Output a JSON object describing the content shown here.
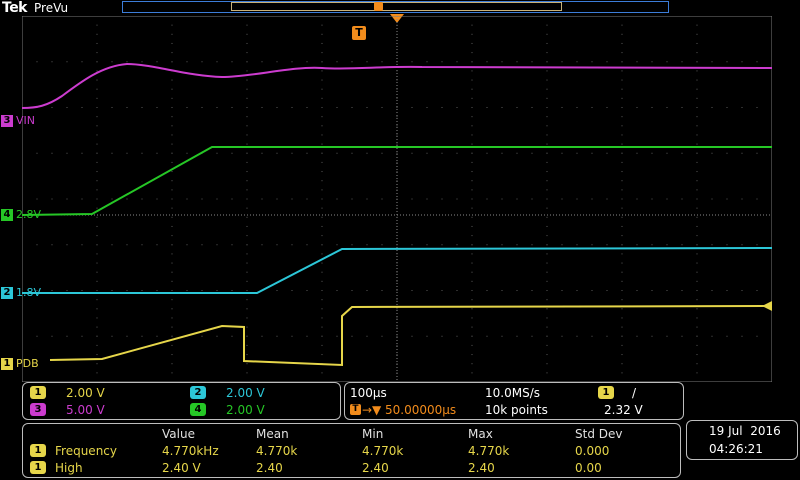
{
  "header": {
    "brand": "Tek",
    "mode": "PreVu",
    "trigger_marker": "T"
  },
  "channels": [
    {
      "id": "3",
      "label": "VIN",
      "color": "#cc3ccf"
    },
    {
      "id": "4",
      "label": "2.8V",
      "color": "#26c726"
    },
    {
      "id": "2",
      "label": "1.8V",
      "color": "#2cc7d8"
    },
    {
      "id": "1",
      "label": "PDB",
      "color": "#e6d64a"
    }
  ],
  "vertical": [
    {
      "id": "1",
      "scale": "2.00 V",
      "color": "#e6d64a"
    },
    {
      "id": "2",
      "scale": "2.00 V",
      "color": "#2cc7d8"
    },
    {
      "id": "3",
      "scale": "5.00 V",
      "color": "#cc3ccf"
    },
    {
      "id": "4",
      "scale": "2.00 V",
      "color": "#26c726"
    }
  ],
  "horizontal": {
    "time_div": "100µs",
    "sample_rate": "10.0MS/s",
    "trigger_source": "1",
    "trigger_slope": "/",
    "trigger_delay": "50.00000µs",
    "record_length": "10k points",
    "trigger_level": "2.32 V"
  },
  "measurements": {
    "headers": [
      "Value",
      "Mean",
      "Min",
      "Max",
      "Std Dev"
    ],
    "rows": [
      {
        "source": "1",
        "name": "Frequency",
        "value": "4.770kHz",
        "mean": "4.770k",
        "min": "4.770k",
        "max": "4.770k",
        "std": "0.000"
      },
      {
        "source": "1",
        "name": "High",
        "value": "2.40 V",
        "mean": "2.40",
        "min": "2.40",
        "max": "2.40",
        "std": "0.00"
      }
    ]
  },
  "datetime": {
    "date": "19 Jul  2016",
    "time": "04:26:21"
  }
}
